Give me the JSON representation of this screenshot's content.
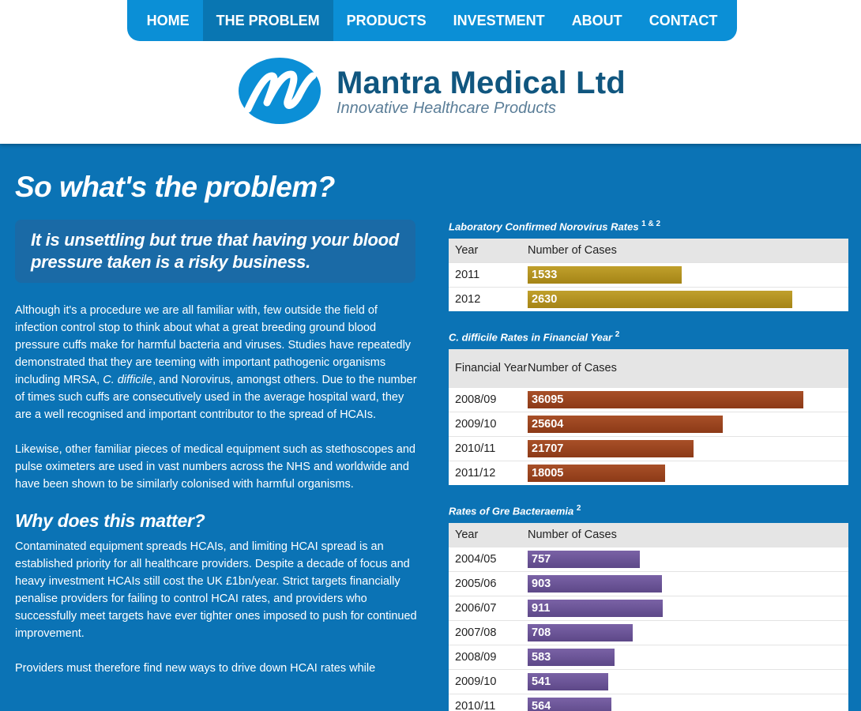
{
  "nav": {
    "items": [
      {
        "label": "HOME",
        "active": false
      },
      {
        "label": "THE PROBLEM",
        "active": true
      },
      {
        "label": "PRODUCTS",
        "active": false
      },
      {
        "label": "INVESTMENT",
        "active": false
      },
      {
        "label": "ABOUT",
        "active": false
      },
      {
        "label": "CONTACT",
        "active": false
      }
    ]
  },
  "brand": {
    "title": "Mantra Medical Ltd",
    "tagline": "Innovative Healthcare Products",
    "logo_icon": "mantra-m-logo",
    "colors": {
      "logo": "#0b8fd6",
      "title": "#10567f",
      "tagline": "#5b7e98"
    }
  },
  "main": {
    "title": "So what's the problem?",
    "callout": "It is unsettling but true that having your blood pressure taken is a risky business.",
    "para1_a": "Although it's a procedure we are all familiar with, few outside the field of infection control stop to think about what a great breeding ground blood pressure cuffs make for harmful bacteria and viruses. Studies have repeatedly demonstrated that they are teeming with important pathogenic organisms including MRSA, ",
    "para1_italic": "C. difficile",
    "para1_b": ", and Norovirus, amongst others. Due to the number of times such cuffs are consecutively used in the average hospital ward, they are a well recognised and important contributor to the spread of HCAIs.",
    "para2": "Likewise, other familiar pieces of medical equipment such as stethoscopes and pulse oximeters are used in vast numbers across the NHS and worldwide and have been shown to be similarly colonised with harmful organisms.",
    "heading2": "Why does this matter?",
    "para3": "Contaminated equipment spreads HCAIs, and limiting HCAI spread is an established priority for all healthcare providers. Despite a decade of focus and heavy investment HCAIs still cost the UK £1bn/year. Strict targets financially penalise providers for failing to control HCAI rates, and providers who successfully meet targets have ever tighter ones imposed to push for continued improvement.",
    "para4": "Providers must therefore find new ways to drive down HCAI rates while"
  },
  "tables": [
    {
      "caption": "Laboratory Confirmed Norovirus Rates",
      "sup": "1 & 2",
      "col1": "Year",
      "col2": "Number of Cases",
      "color": "gold",
      "max": 2950,
      "rows": [
        {
          "label": "2011",
          "value": 1533
        },
        {
          "label": "2012",
          "value": 2630
        }
      ]
    },
    {
      "caption": "C. difficile Rates in Financial Year",
      "sup": "2",
      "col1": "Financial Year",
      "col2": "Number of Cases",
      "color": "rust",
      "max": 38900,
      "rows": [
        {
          "label": "2008/09",
          "value": 36095
        },
        {
          "label": "2009/10",
          "value": 25604
        },
        {
          "label": "2010/11",
          "value": 21707
        },
        {
          "label": "2011/12",
          "value": 18005
        }
      ]
    },
    {
      "caption": "Rates of Gre Bacteraemia",
      "sup": "2",
      "col1": "Year",
      "col2": "Number of Cases",
      "color": "purple",
      "max": 2000,
      "rows": [
        {
          "label": "2004/05",
          "value": 757
        },
        {
          "label": "2005/06",
          "value": 903
        },
        {
          "label": "2006/07",
          "value": 911
        },
        {
          "label": "2007/08",
          "value": 708
        },
        {
          "label": "2008/09",
          "value": 583
        },
        {
          "label": "2009/10",
          "value": 541
        },
        {
          "label": "2010/11",
          "value": 564
        }
      ]
    }
  ]
}
